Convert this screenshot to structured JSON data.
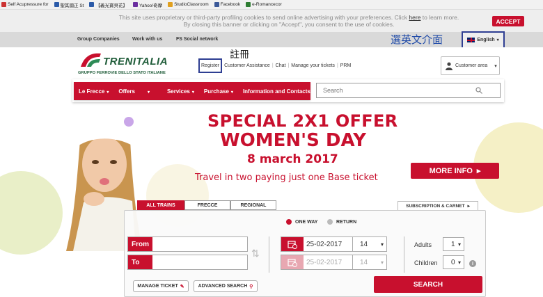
{
  "bookmarks": [
    "Self Acupressure for",
    "聖其國正 St",
    "【義光寶貝花】",
    "Yahoo!奇摩",
    "StudioClassroom",
    "Facebook",
    "e-Romancecor"
  ],
  "cookie": {
    "text_before": "This site uses proprietary or third-party profiling cookies to send online advertising with your preferences. Click ",
    "link": "here",
    "text_after": " to learn more.",
    "line2": "By closing this banner or clicking on \"Accept\", you consent to the use of cookies.",
    "accept": "ACCEPT"
  },
  "topnav": {
    "items": [
      "Group Companies",
      "Work with us",
      "FS Social network"
    ],
    "language": "English"
  },
  "annotations": {
    "language_note": "選英文介面",
    "register_note": "註冊"
  },
  "logo": {
    "brand": "TRENITALIA",
    "sub": "GRUPPO FERROVIE DELLO STATO ITALIANE"
  },
  "header_links": [
    "Register",
    "Customer Assistance",
    "Chat",
    "Manage your tickets",
    "PRM"
  ],
  "customer_area": "Customer area",
  "mainnav": [
    "Le Frecce",
    "Offers",
    "Services",
    "Purchase",
    "Information and Contacts"
  ],
  "search": {
    "placeholder": "Search"
  },
  "promo": {
    "title": "SPECIAL 2X1 OFFER",
    "subtitle": "WOMEN'S DAY",
    "date": "8 march 2017",
    "description": "Travel in two paying just one Base ticket",
    "more": "MORE INFO"
  },
  "booking": {
    "tabs": [
      "ALL TRAINS",
      "FRECCE",
      "REGIONAL"
    ],
    "subscription": "SUBSCRIPTION & CARNET",
    "trip": {
      "one_way": "ONE WAY",
      "return": "RETURN"
    },
    "from_label": "From",
    "to_label": "To",
    "outbound_date": "25-02-2017",
    "outbound_hour": "14",
    "return_date": "25-02-2017",
    "return_hour": "14",
    "adults_label": "Adults",
    "adults": "1",
    "children_label": "Children",
    "children": "0",
    "manage_ticket": "MANAGE TICKET",
    "advanced_search": "ADVANCED SEARCH",
    "search_button": "SEARCH"
  },
  "colors": {
    "brand_red": "#c8102e",
    "brand_green": "#1f5c39",
    "annotation_blue": "#2e3e92"
  }
}
